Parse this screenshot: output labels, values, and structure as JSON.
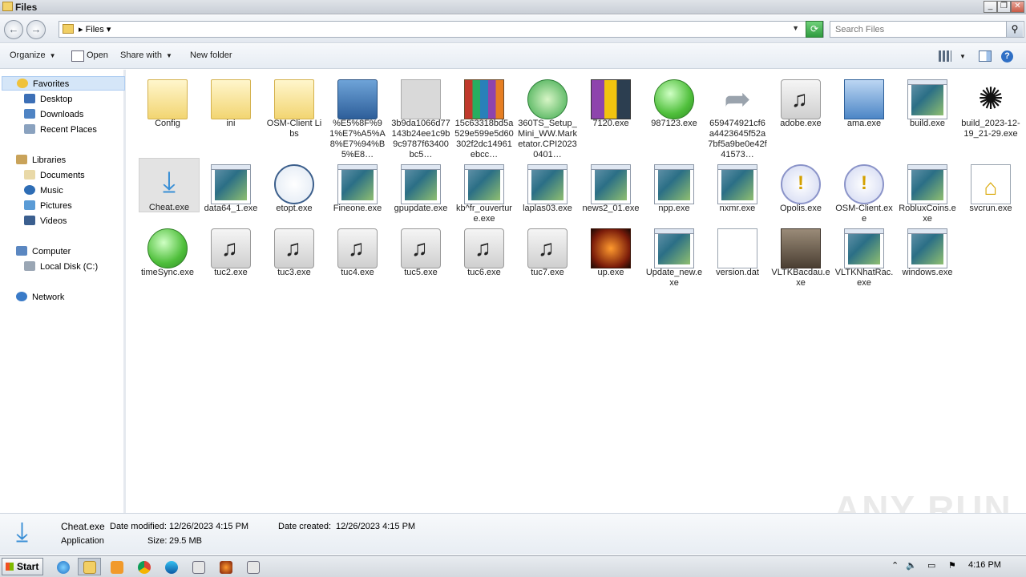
{
  "window": {
    "title": "Files"
  },
  "address": {
    "crumb": "Files"
  },
  "search": {
    "placeholder": "Search Files"
  },
  "toolbar": {
    "organize": "Organize",
    "open": "Open",
    "share_with": "Share with",
    "new_folder": "New folder"
  },
  "nav": {
    "favorites": "Favorites",
    "desktop": "Desktop",
    "downloads": "Downloads",
    "recent_places": "Recent Places",
    "libraries": "Libraries",
    "documents": "Documents",
    "music": "Music",
    "pictures": "Pictures",
    "videos": "Videos",
    "computer": "Computer",
    "local_disk": "Local Disk (C:)",
    "network": "Network"
  },
  "files": [
    {
      "name": "Config",
      "icon": "folder-icon"
    },
    {
      "name": "ini",
      "icon": "folder-icon"
    },
    {
      "name": "OSM-Client Libs",
      "icon": "folder-icon"
    },
    {
      "name": "%E5%8F%91%E7%A5%A8%E7%94%B5%E8…",
      "icon": "shield-folder-icon"
    },
    {
      "name": "3b9da1066d77143b24ee1c9b9c9787f63400bc5…",
      "icon": "blank-app-icon"
    },
    {
      "name": "15c63318bd5a529e599e5d60302f2dc14961ebcc…",
      "icon": "winrar-icon"
    },
    {
      "name": "360TS_Setup_Mini_WW.Marketator.CPI20230401…",
      "icon": "installer-icon"
    },
    {
      "name": "7120.exe",
      "icon": "archive-icon"
    },
    {
      "name": "987123.exe",
      "icon": "green-circle-icon"
    },
    {
      "name": "659474921cf6a4423645f52a7bf5a9be0e42f41573…",
      "icon": "arrow-icon"
    },
    {
      "name": "adobe.exe",
      "icon": "music-icon"
    },
    {
      "name": "ama.exe",
      "icon": "computer-icon"
    },
    {
      "name": "build.exe",
      "icon": "window-icon"
    },
    {
      "name": "build_2023-12-19_21-29.exe",
      "icon": "spinner-icon"
    },
    {
      "name": "Cheat.exe",
      "icon": "download-icon"
    },
    {
      "name": "data64_1.exe",
      "icon": "window-icon"
    },
    {
      "name": "etopt.exe",
      "icon": "clock-icon"
    },
    {
      "name": "Fineone.exe",
      "icon": "window-icon"
    },
    {
      "name": "gpupdate.exe",
      "icon": "window-icon"
    },
    {
      "name": "kb^fr_ouverture.exe",
      "icon": "window-icon"
    },
    {
      "name": "laplas03.exe",
      "icon": "window-icon"
    },
    {
      "name": "news2_01.exe",
      "icon": "window-icon"
    },
    {
      "name": "npp.exe",
      "icon": "window-icon"
    },
    {
      "name": "nxmr.exe",
      "icon": "window-icon"
    },
    {
      "name": "Opolis.exe",
      "icon": "alert-icon"
    },
    {
      "name": "OSM-Client.exe",
      "icon": "alert-icon"
    },
    {
      "name": "RobluxCoins.exe",
      "icon": "window-icon"
    },
    {
      "name": "svcrun.exe",
      "icon": "doc-house-icon"
    },
    {
      "name": "timeSync.exe",
      "icon": "green-circle-icon"
    },
    {
      "name": "tuc2.exe",
      "icon": "music-icon"
    },
    {
      "name": "tuc3.exe",
      "icon": "music-icon"
    },
    {
      "name": "tuc4.exe",
      "icon": "music-icon"
    },
    {
      "name": "tuc5.exe",
      "icon": "music-icon"
    },
    {
      "name": "tuc6.exe",
      "icon": "music-icon"
    },
    {
      "name": "tuc7.exe",
      "icon": "music-icon"
    },
    {
      "name": "up.exe",
      "icon": "game-icon"
    },
    {
      "name": "Update_new.exe",
      "icon": "window-icon"
    },
    {
      "name": "version.dat",
      "icon": "document-icon"
    },
    {
      "name": "VLTKBacdau.exe",
      "icon": "warrior-icon"
    },
    {
      "name": "VLTKNhatRac.exe",
      "icon": "window-icon"
    },
    {
      "name": "windows.exe",
      "icon": "window-icon"
    }
  ],
  "details": {
    "filename": "Cheat.exe",
    "type": "Application",
    "date_modified_label": "Date modified:",
    "date_modified": "12/26/2023 4:15 PM",
    "date_created_label": "Date created:",
    "date_created": "12/26/2023 4:15 PM",
    "size_label": "Size:",
    "size": "29.5 MB"
  },
  "taskbar": {
    "start": "Start",
    "clock": "4:16 PM"
  },
  "watermark": "ANY RUN"
}
